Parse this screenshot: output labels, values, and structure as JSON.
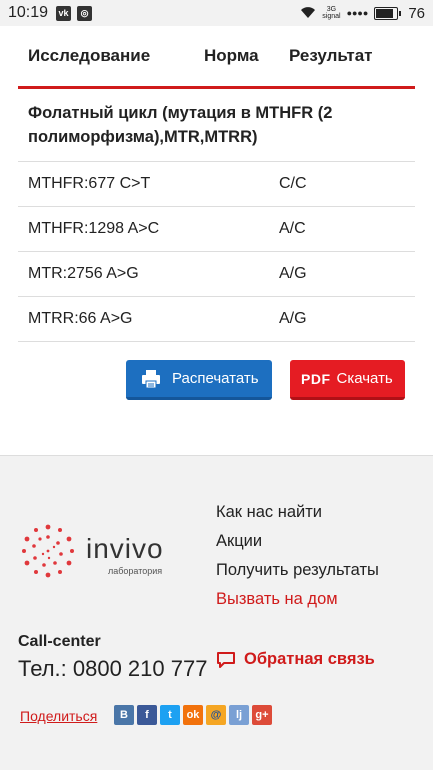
{
  "status_bar": {
    "time": "10:19",
    "net_label": "3G",
    "signal_label": "signal",
    "battery": "76"
  },
  "table": {
    "headers": [
      "Исследование",
      "Норма",
      "Результат"
    ],
    "group_title": "Фолатный цикл (мутация в MTHFR (2 полиморфизма),MTR,MTRR)",
    "rows": [
      {
        "name": "MTHFR:677 C>T",
        "norm": "",
        "result": "C/C"
      },
      {
        "name": "MTHFR:1298 A>C",
        "norm": "",
        "result": "A/C"
      },
      {
        "name": "MTR:2756 A>G",
        "norm": "",
        "result": "A/G"
      },
      {
        "name": "MTRR:66 A>G",
        "norm": "",
        "result": "A/G"
      }
    ]
  },
  "actions": {
    "print_label": "Распечатать",
    "pdf_badge": "PDF",
    "download_label": "Скачать"
  },
  "footer": {
    "brand": "invivo",
    "brand_sub": "лаборатория",
    "links": [
      "Как нас найти",
      "Акции",
      "Получить результаты",
      "Вызвать на дом"
    ],
    "call_center_label": "Call-center",
    "phone": "Тел.: 0800 210 777",
    "feedback_label": "Обратная связь",
    "share_label": "Поделиться",
    "socials": [
      "В",
      "f",
      "t",
      "ok",
      "@",
      "lj",
      "g+"
    ]
  },
  "colors": {
    "accent": "#d01b1b",
    "print_button": "#1d6fc0",
    "pdf_button": "#e51c23"
  }
}
